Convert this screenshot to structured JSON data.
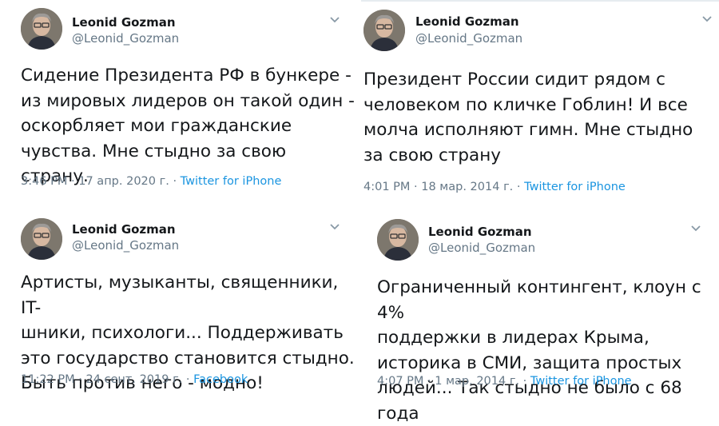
{
  "colors": {
    "link": "#1b95e0",
    "muted": "#657786",
    "text": "#14171a"
  },
  "icons": {
    "menu": "chevron-down-icon"
  },
  "tweets": [
    {
      "name": "Leonid Gozman",
      "handle": "@Leonid_Gozman",
      "text": "Сидение Президента РФ в бункере -\nиз мировых лидеров он такой один -\nоскорбляет мои гражданские\nчувства. Мне стыдно за свою страну.",
      "time": "3:46 PM · 17 апр. 2020 г. · ",
      "source": "Twitter for iPhone"
    },
    {
      "name": "Leonid Gozman",
      "handle": "@Leonid_Gozman",
      "text": "Президент России сидит рядом с\nчеловеком по кличке Гоблин! И все\nмолча исполняют гимн. Мне стыдно\nза свою страну",
      "time": "4:01 PM · 18 мар. 2014 г. · ",
      "source": "Twitter for iPhone"
    },
    {
      "name": "Leonid Gozman",
      "handle": "@Leonid_Gozman",
      "text": "Артисты, музыканты, священники, IT-\nшники, психологи... Поддерживать\nэто государство становится стыдно.\nБыть против него - модно!",
      "time": "11:22 PM · 24 сент. 2019 г. · ",
      "source": "Facebook"
    },
    {
      "name": "Leonid Gozman",
      "handle": "@Leonid_Gozman",
      "text": "Ограниченный контингент, клоун с 4%\nподдержки в лидерах Крыма,\nисторика в СМИ, защита простых\nлюдей... Так стыдно не было с 68 года",
      "time": "4:07 PM · 1 мар. 2014 г. · ",
      "source": "Twitter for iPhone"
    }
  ]
}
